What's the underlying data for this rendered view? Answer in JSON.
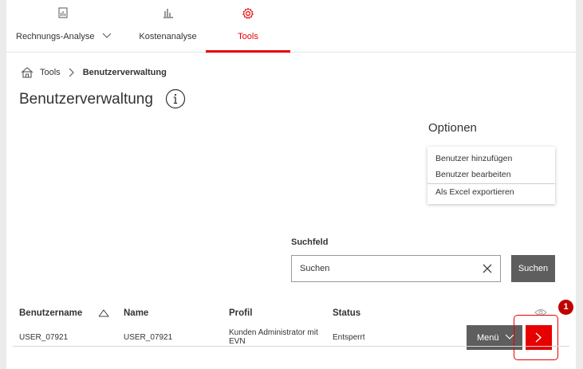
{
  "nav": {
    "items": [
      {
        "label": "Rechnungs-Analyse",
        "icon": "document-icon",
        "active": false
      },
      {
        "label": "Kostenanalyse",
        "icon": "bar-chart-icon",
        "active": false
      },
      {
        "label": "Tools",
        "icon": "gear-icon",
        "active": true
      }
    ]
  },
  "breadcrumb": {
    "home": "Tools",
    "current": "Benutzerverwaltung"
  },
  "page": {
    "title": "Benutzerverwaltung"
  },
  "options": {
    "title": "Optionen",
    "items": [
      "Benutzer hinzufügen",
      "Benutzer bearbeiten",
      "Als Excel exportieren"
    ]
  },
  "search": {
    "label": "Suchfeld",
    "placeholder": "Suchen",
    "button": "Suchen"
  },
  "table": {
    "headers": [
      "Benutzername",
      "Name",
      "Profil",
      "Status"
    ],
    "rows": [
      {
        "username": "USER_07921",
        "name": "USER_07921",
        "profile_line1": "Kunden Administrator mit",
        "profile_line2": "EVN",
        "status": "Entsperrt"
      }
    ],
    "menu_label": "Menü"
  },
  "annotation": {
    "step": "1"
  },
  "colors": {
    "accent": "#e60000",
    "button_gray": "#5e5e5e"
  }
}
